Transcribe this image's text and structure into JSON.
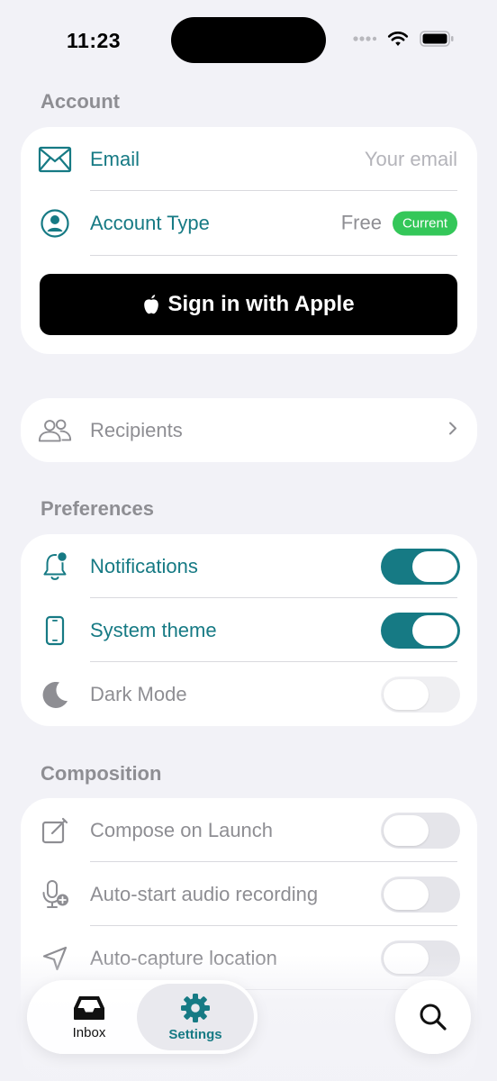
{
  "status_bar": {
    "time": "11:23"
  },
  "sections": {
    "account": "Account",
    "preferences": "Preferences",
    "composition": "Composition"
  },
  "account": {
    "email_label": "Email",
    "email_placeholder": "Your email",
    "account_type_label": "Account Type",
    "account_type_value": "Free",
    "account_type_badge": "Current",
    "sign_in_label": "Sign in with Apple"
  },
  "recipients": {
    "label": "Recipients"
  },
  "preferences": {
    "items": [
      {
        "label": "Notifications",
        "on": true
      },
      {
        "label": "System theme",
        "on": true
      },
      {
        "label": "Dark Mode",
        "on": false
      }
    ]
  },
  "composition": {
    "items": [
      {
        "label": "Compose on Launch",
        "on": false
      },
      {
        "label": "Auto-start audio recording",
        "on": false
      },
      {
        "label": "Auto-capture location",
        "on": false
      }
    ]
  },
  "tab_bar": {
    "inbox_label": "Inbox",
    "settings_label": "Settings",
    "selected": "Settings"
  },
  "colors": {
    "accent": "#167a84",
    "badge_green": "#34c759",
    "background": "#f2f2f7"
  },
  "icons": {
    "email": "envelope-icon",
    "account_type": "person-circle-icon",
    "apple": "apple-logo-icon",
    "recipients": "people-icon",
    "notifications": "bell-badge-icon",
    "system_theme": "phone-icon",
    "dark_mode": "moon-icon",
    "compose": "compose-icon",
    "audio": "mic-plus-icon",
    "location": "location-arrow-icon",
    "inbox": "tray-icon",
    "settings": "gear-icon",
    "search": "search-icon"
  }
}
